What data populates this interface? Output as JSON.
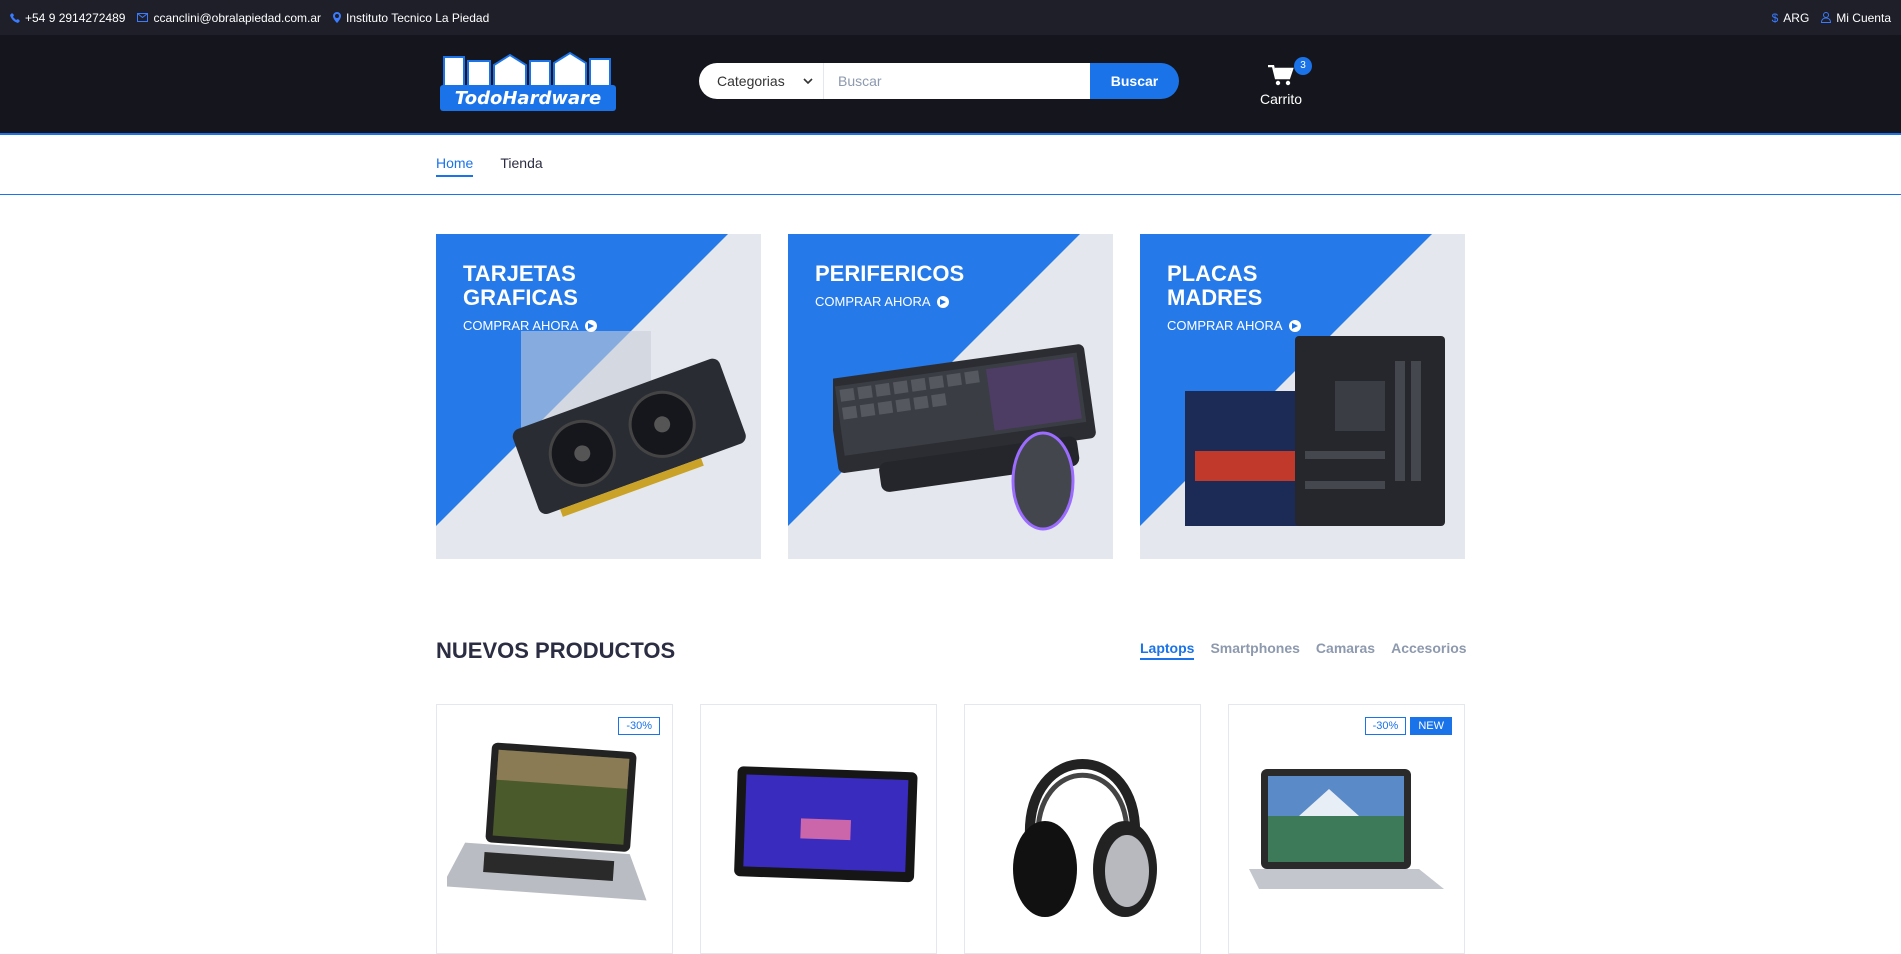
{
  "topbar": {
    "phone": "+54 9 2914272489",
    "email": "ccanclini@obralapiedad.com.ar",
    "location": "Instituto Tecnico La Piedad",
    "currency": "ARG",
    "account": "Mi Cuenta"
  },
  "header": {
    "logo_text": "TodoHardware",
    "category_select": "Categorias",
    "search_placeholder": "Buscar",
    "search_button": "Buscar",
    "cart_label": "Carrito",
    "cart_qty": "3"
  },
  "nav": {
    "items": [
      {
        "label": "Home"
      },
      {
        "label": "Tienda"
      }
    ]
  },
  "collections": [
    {
      "title_line1": "TARJETAS",
      "title_line2": "GRAFICAS",
      "cta": "COMPRAR AHORA"
    },
    {
      "title_line1": "PERIFERICOS",
      "title_line2": "",
      "cta": "COMPRAR AHORA"
    },
    {
      "title_line1": "PLACAS",
      "title_line2": "MADRES",
      "cta": "COMPRAR AHORA"
    }
  ],
  "section": {
    "title": "NUEVOS PRODUCTOS",
    "tabs": [
      {
        "label": "Laptops"
      },
      {
        "label": "Smartphones"
      },
      {
        "label": "Camaras"
      },
      {
        "label": "Accesorios"
      }
    ]
  },
  "products": [
    {
      "sale": "-30%",
      "new": ""
    },
    {
      "sale": "",
      "new": ""
    },
    {
      "sale": "",
      "new": ""
    },
    {
      "sale": "-30%",
      "new": "NEW"
    }
  ],
  "colors": {
    "accent": "#1a73e8",
    "topbar_bg": "#1e1f29",
    "header_bg": "#15161d",
    "collection_bg": "#e4e7ed"
  }
}
